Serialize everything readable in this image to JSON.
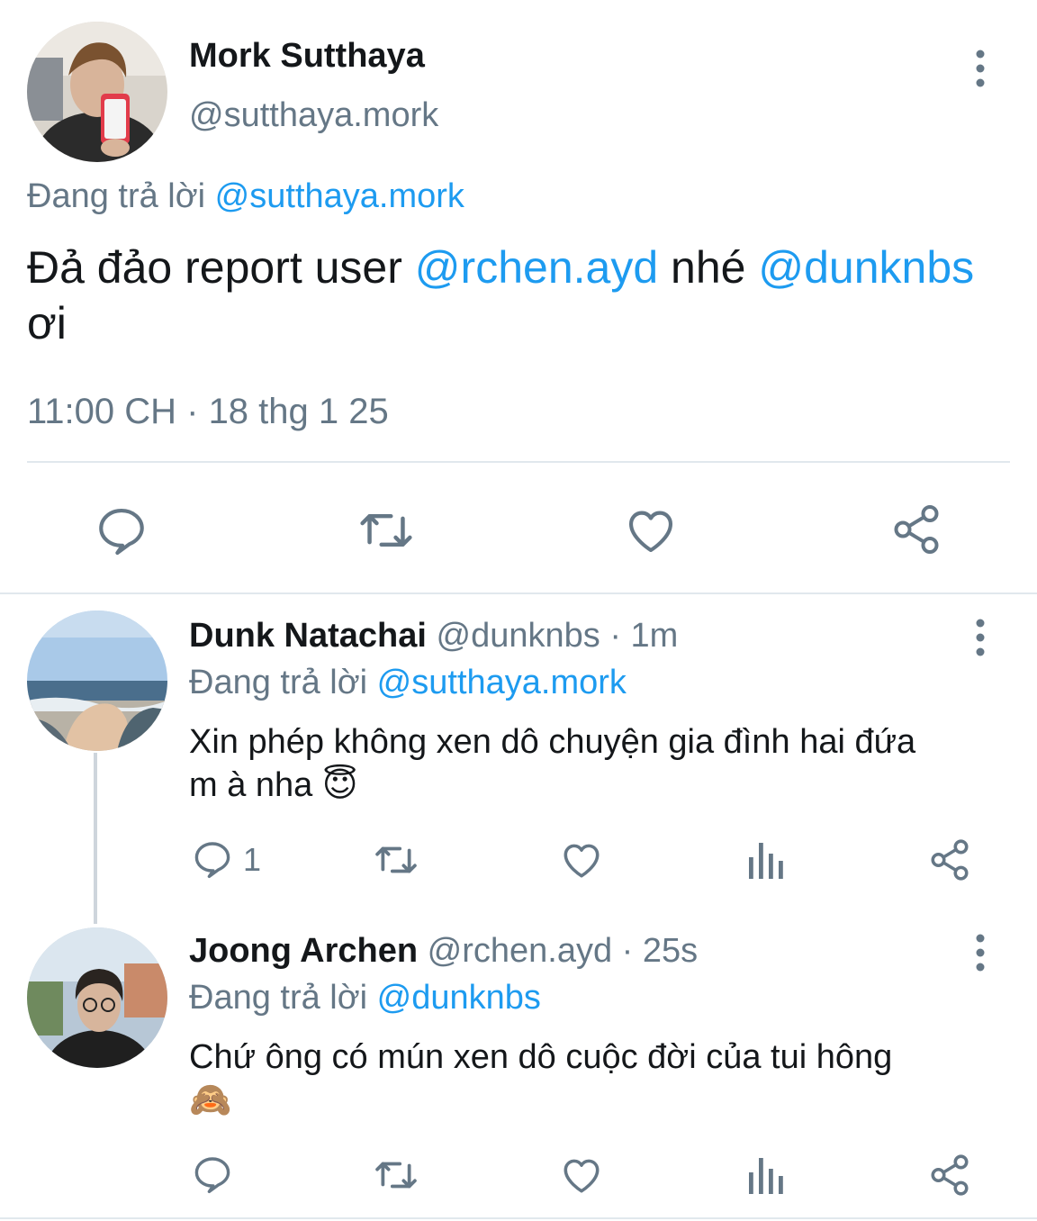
{
  "main_tweet": {
    "author_name": "Mork Sutthaya",
    "handle": "@sutthaya.mork",
    "replying_prefix": "Đang trả lời",
    "replying_to": "@sutthaya.mork",
    "text_part1": "Đả đảo report user ",
    "mention1": "@rchen.ayd",
    "text_part2": " nhé ",
    "mention2": "@dunknbs",
    "text_part3": "ơi",
    "timestamp": "11:00 CH · 18 thg 1 25"
  },
  "replies": [
    {
      "author_name": "Dunk Natachai",
      "handle": "@dunknbs",
      "time": " · 1m",
      "replying_prefix": "Đang trả lời",
      "replying_to": "@sutthaya.mork",
      "text_line1": "Xin phép không xen dô chuyện gia đình hai đứa",
      "text_line2": "m à nha ",
      "emoji": "😇",
      "reply_count": "1"
    },
    {
      "author_name": "Joong Archen",
      "handle": "@rchen.ayd",
      "time": " · 25s",
      "replying_prefix": "Đang trả lời",
      "replying_to": "@dunknbs",
      "text_line1": "Chứ ông có mún xen dô cuộc đời của tui hông",
      "emoji": "🙈",
      "reply_count": ""
    }
  ],
  "colors": {
    "link": "#1d9bf0",
    "secondary": "#657786",
    "divider": "#e1e8ed"
  },
  "icons": [
    "reply-icon",
    "retweet-icon",
    "like-icon",
    "views-icon",
    "share-icon",
    "more-icon"
  ]
}
